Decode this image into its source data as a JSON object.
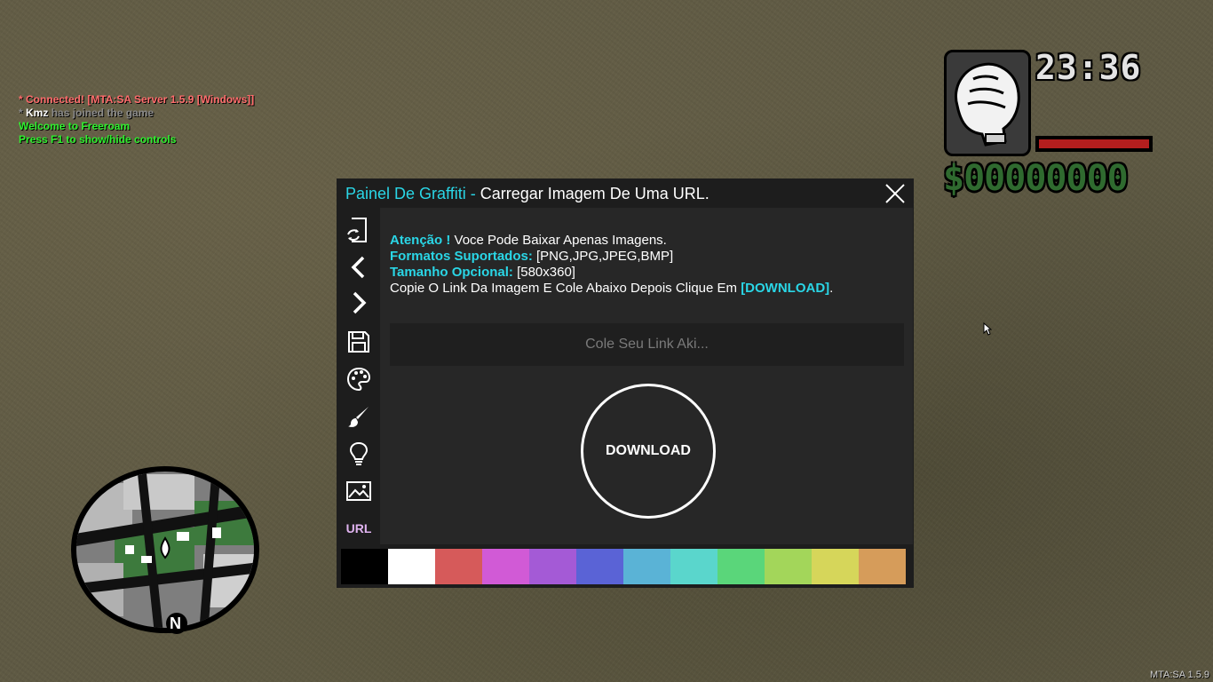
{
  "chat": {
    "lines": [
      {
        "text": "* Connected! [MTA:SA Server 1.5.9 [Windows]]",
        "color": "#ff6c6c"
      },
      {
        "prefix": "* ",
        "name": "Kmz",
        "text": " has joined the game",
        "color": "#8a8a8a"
      },
      {
        "text": "Welcome to Freeroam",
        "color": "#2ef12e"
      },
      {
        "text": "Press F1 to show/hide controls",
        "color": "#2ef12e"
      }
    ]
  },
  "hud": {
    "weapon_icon": "fist-icon",
    "clock": "23:36",
    "health_level": 1.0,
    "health_color": "#b41e1e",
    "money": "$00000000"
  },
  "radar": {
    "north_label": "N"
  },
  "panel": {
    "title_accent": "Painel De Graffiti - ",
    "title_rest": "Carregar Imagem De Uma URL.",
    "sidebar": {
      "icons": [
        "reload-page-icon",
        "chevron-left-icon",
        "chevron-right-icon",
        "save-icon",
        "palette-icon",
        "brush-icon",
        "lightbulb-icon",
        "image-icon"
      ],
      "url_label": "URL"
    },
    "info": {
      "attention_key": "Atenção !",
      "attention_text": " Voce Pode Baixar Apenas Imagens.",
      "formats_key": "Formatos Suportados:",
      "formats_text": " [PNG,JPG,JPEG,BMP]",
      "size_key": "Tamanho Opcional:",
      "size_text": " [580x360]",
      "instruction_text": "Copie O Link Da Imagem E Cole Abaixo Depois Clique Em ",
      "instruction_key": "[DOWNLOAD]",
      "instruction_end": "."
    },
    "link_input": {
      "value": "",
      "placeholder": "Cole Seu Link Aki..."
    },
    "download_label": "DOWNLOAD",
    "palette": [
      "#000000",
      "#ffffff",
      "#d65a5a",
      "#d15ad6",
      "#a45ad6",
      "#5a63d6",
      "#5ab3d6",
      "#5ad6cc",
      "#5ad67a",
      "#a3d65a",
      "#d6d65a",
      "#d69c5a"
    ]
  },
  "version": "MTA:SA 1.5.9"
}
